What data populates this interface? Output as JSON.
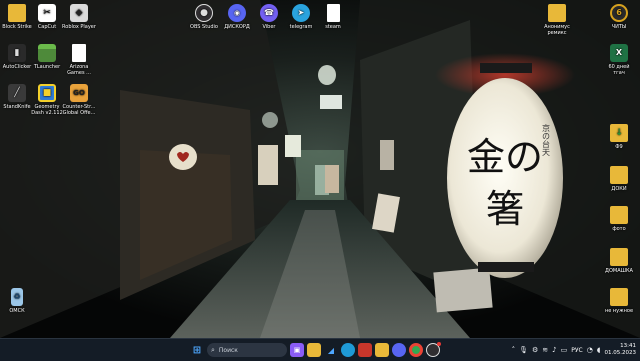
{
  "desktop": {
    "left_icons": [
      {
        "label": "Block Strike",
        "icon": "folder-icon",
        "color": "#e8b839"
      },
      {
        "label": "CapCut",
        "icon": "capcut-icon",
        "color": "#ffffff"
      },
      {
        "label": "Roblox Player",
        "icon": "roblox-icon",
        "color": "#dadada"
      },
      {
        "label": "AutoClicker",
        "icon": "mouse-icon",
        "color": "#2a2a2a"
      },
      {
        "label": "TLauncher",
        "icon": "minecraft-icon",
        "color": "#4e8a3a"
      },
      {
        "label": "Arizona Games ...",
        "icon": "document-icon",
        "color": "#ffffff"
      },
      {
        "label": "StandKnife",
        "icon": "knife-icon",
        "color": "#3a3a3a"
      },
      {
        "label": "Geometry Dash v2.112",
        "icon": "geometry-dash-icon",
        "color": "#2f7bd6"
      },
      {
        "label": "Counter-Str... Global Offe...",
        "icon": "csgo-icon",
        "color": "#e9a23b"
      },
      {
        "label": "ОМСК",
        "icon": "recycle-bin-icon",
        "color": "#9cc7e8"
      }
    ],
    "top_icons": [
      {
        "label": "OBS Studio",
        "icon": "obs-icon",
        "color": "#302e31"
      },
      {
        "label": "ДИСКОРД",
        "icon": "discord-icon",
        "color": "#5865f2"
      },
      {
        "label": "Viber",
        "icon": "viber-icon",
        "color": "#7360f2"
      },
      {
        "label": "telegram",
        "icon": "telegram-icon",
        "color": "#2aa3de"
      },
      {
        "label": "steam",
        "icon": "document-icon",
        "color": "#ffffff"
      }
    ],
    "right_icons": [
      {
        "label": "Анонимус ремикс",
        "icon": "folder-icon",
        "color": "#e8b839"
      },
      {
        "label": "ЧИТЫ",
        "icon": "cheat-icon",
        "color": "#d7a21e"
      },
      {
        "label": "60 дней тгач",
        "icon": "excel-icon",
        "color": "#1f7244"
      },
      {
        "label": "Ф9",
        "icon": "folder-green-icon",
        "color": "#e8b839"
      },
      {
        "label": "ДОКИ",
        "icon": "folder-icon",
        "color": "#e8b839"
      },
      {
        "label": "фото",
        "icon": "folder-icon",
        "color": "#e8b839"
      },
      {
        "label": "ДОМАШКА",
        "icon": "folder-icon",
        "color": "#e8b839"
      },
      {
        "label": "не нужное",
        "icon": "folder-icon",
        "color": "#e8b839"
      }
    ]
  },
  "taskbar": {
    "search_placeholder": "Поиск",
    "language": "РУС",
    "time": "13:41",
    "date": "01.05.2023"
  }
}
